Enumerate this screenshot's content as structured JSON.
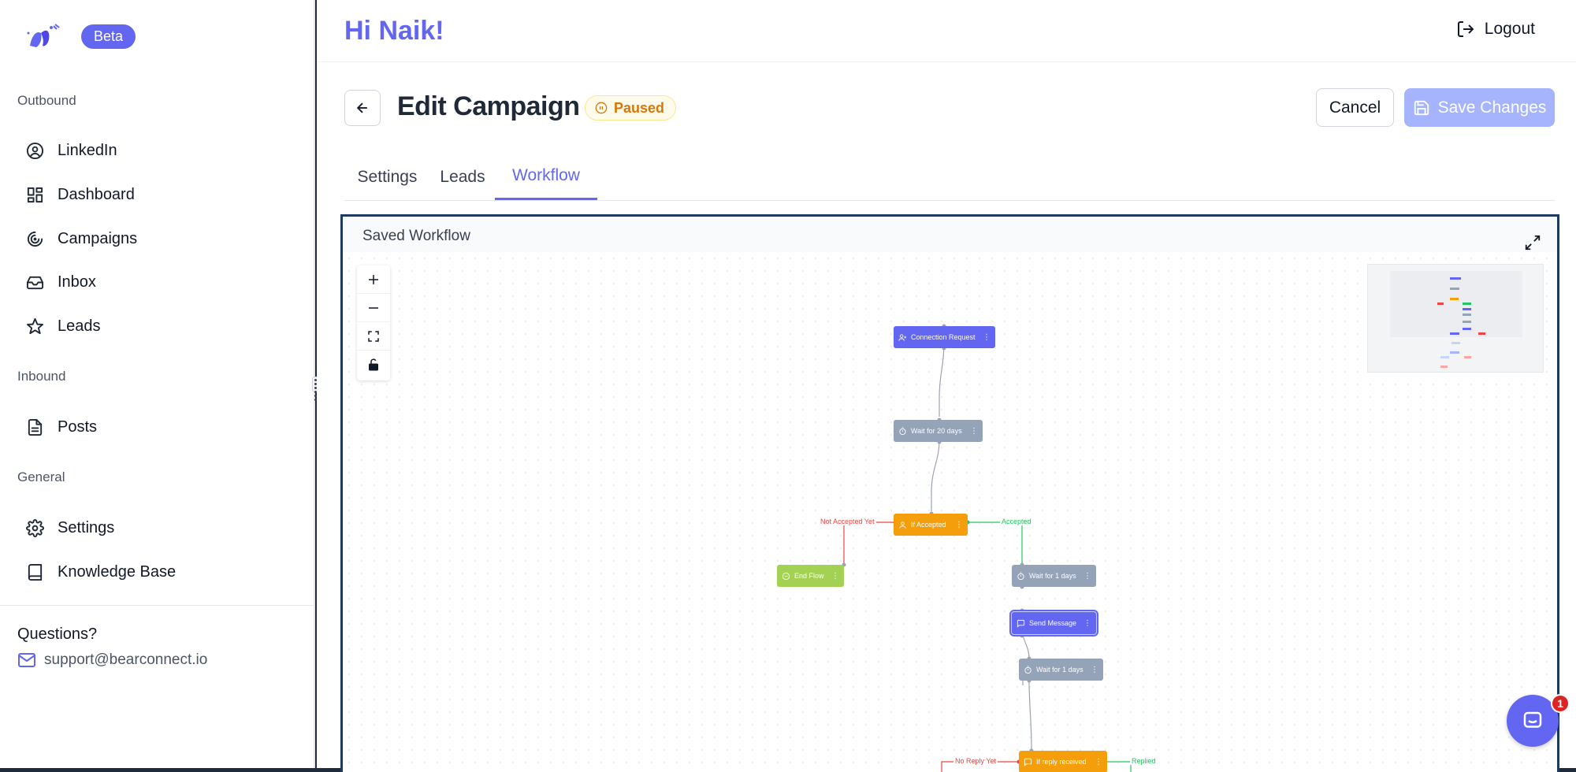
{
  "brand": {
    "badge": "Beta",
    "accent": "#6366f1"
  },
  "sidebar": {
    "sections": [
      "Outbound",
      "Inbound",
      "General"
    ],
    "items": [
      {
        "label": "LinkedIn",
        "icon": "user-circle-icon"
      },
      {
        "label": "Dashboard",
        "icon": "dashboard-icon"
      },
      {
        "label": "Campaigns",
        "icon": "target-icon"
      },
      {
        "label": "Inbox",
        "icon": "inbox-icon"
      },
      {
        "label": "Leads",
        "icon": "star-icon"
      },
      {
        "label": "Posts",
        "icon": "document-icon"
      },
      {
        "label": "Settings",
        "icon": "gear-icon"
      },
      {
        "label": "Knowledge Base",
        "icon": "book-icon"
      }
    ],
    "questions": "Questions?",
    "support_email": "support@bearconnect.io"
  },
  "header": {
    "greeting": "Hi Naik!",
    "logout": "Logout"
  },
  "page": {
    "title": "Edit Campaign",
    "status": "Paused",
    "cancel": "Cancel",
    "save": "Save Changes"
  },
  "tabs": [
    {
      "label": "Settings",
      "active": false
    },
    {
      "label": "Leads",
      "active": false
    },
    {
      "label": "Workflow",
      "active": true
    }
  ],
  "workflow": {
    "title": "Saved Workflow",
    "nodes": {
      "connection_request": "Connection Request",
      "wait_20": "Wait for 20 days",
      "if_accepted": "If Accepted",
      "end_flow": "End Flow",
      "wait_1a": "Wait for 1 days",
      "send_message": "Send Message",
      "wait_1b": "Wait for 1 days",
      "if_reply": "If reply received"
    },
    "edges": {
      "not_accepted": "Not Accepted Yet",
      "accepted": "Accepted",
      "no_reply": "No Reply Yet",
      "replied": "Replied"
    }
  },
  "chat": {
    "unread": "1"
  }
}
